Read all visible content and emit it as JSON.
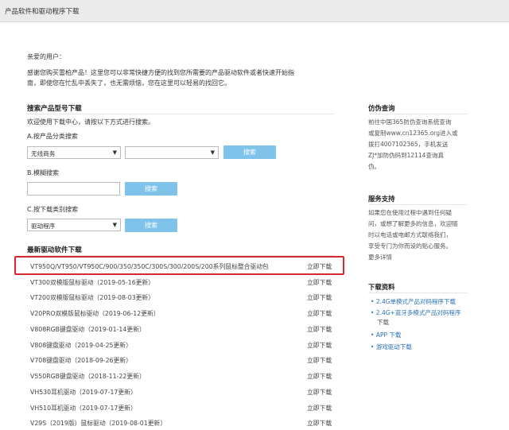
{
  "header": {
    "title": "产品软件和驱动程序下载"
  },
  "greeting": "亲爱的用户：",
  "intro": [
    "感谢您购买雷柏产品！这里您可以非常快捷方便的找到您所需要的产品驱动软件或者快速开始指",
    "南，即使您在忙乱中丢失了，也无需烦恼，您在这里可以轻易的找回它。"
  ],
  "search": {
    "title": "搜索产品型号下载",
    "subtitle": "欢迎使用下载中心，请按以下方式进行搜索。",
    "a_label": "A.按产品分类搜索",
    "a_select1": "无线商务",
    "a_select2": "",
    "a_button": "搜索",
    "b_label": "B.模糊搜索",
    "b_placeholder": "",
    "b_button": "搜索",
    "c_label": "C.按下载类别搜索",
    "c_select": "驱动程序",
    "c_button": "搜索"
  },
  "latest": {
    "title": "最新驱动软件下载",
    "download_label": "立即下载",
    "items": [
      "VT950Q/VT950/VT950C/900/350/350C/300S/300/200S/200系列鼠标整合驱动包",
      "VT300双模版鼠标驱动（2019-05-16更新）",
      "VT200双模版鼠标驱动（2019-08-03更新）",
      "V20PRO双模版鼠标驱动（2019-06-12更新）",
      "V808RGB键盘驱动（2019-01-14更新）",
      "V808键盘驱动（2019-04-25更新）",
      "V708键盘驱动（2018-09-26更新）",
      "V550RGB键盘驱动（2018-11-22更新）",
      "VH530耳机驱动（2019-07-17更新）",
      "VH510耳机驱动（2019-07-17更新）",
      "V29S（2019版）鼠标驱动（2019-08-01更新）"
    ]
  },
  "sidebar": {
    "anti_fake": {
      "title": "仿伪查询",
      "lines": [
        "前往中国365防伪查询系统查询",
        "或复制www.cn12365.org进入或",
        "拨打4007102365，手机发送",
        "ZJ*加防伪码到12114查询真",
        "伪。"
      ]
    },
    "service": {
      "title": "服务支持",
      "lines": [
        "如果您在使用过程中遇到任何疑",
        "问，或想了解更多的信息，欢迎随",
        "时以电话或电邮方式联络我们，",
        "享受专门为你而设的贴心服务。"
      ],
      "more": "更多详情"
    },
    "downloads": {
      "title": "下载资料",
      "items": [
        "2.4G单模式产品对码程序下载",
        "2.4G+蓝牙多模式产品对码程序",
        "下载",
        "APP 下载",
        "游戏驱动下载"
      ]
    }
  }
}
